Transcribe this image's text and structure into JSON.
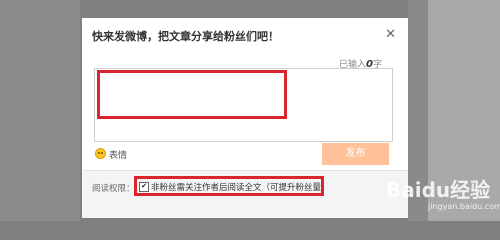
{
  "dialog": {
    "title": "快来发微博，把文章分享给粉丝们吧！",
    "close_icon": "close-icon",
    "count_prefix": "已输入",
    "count_value": "0",
    "count_suffix": "字",
    "emoji_label": "表情",
    "publish_label": "发布",
    "permission_label": "阅读权限：",
    "permission_option": "非粉丝需关注作者后阅读全文（可提升粉丝量）",
    "permission_checked": true
  },
  "watermark": {
    "text": "Baidu经验",
    "sub": "jingyan.baidu.com"
  },
  "colors": {
    "annotation_red": "#d9262d",
    "publish_button": "#ffc09a"
  }
}
